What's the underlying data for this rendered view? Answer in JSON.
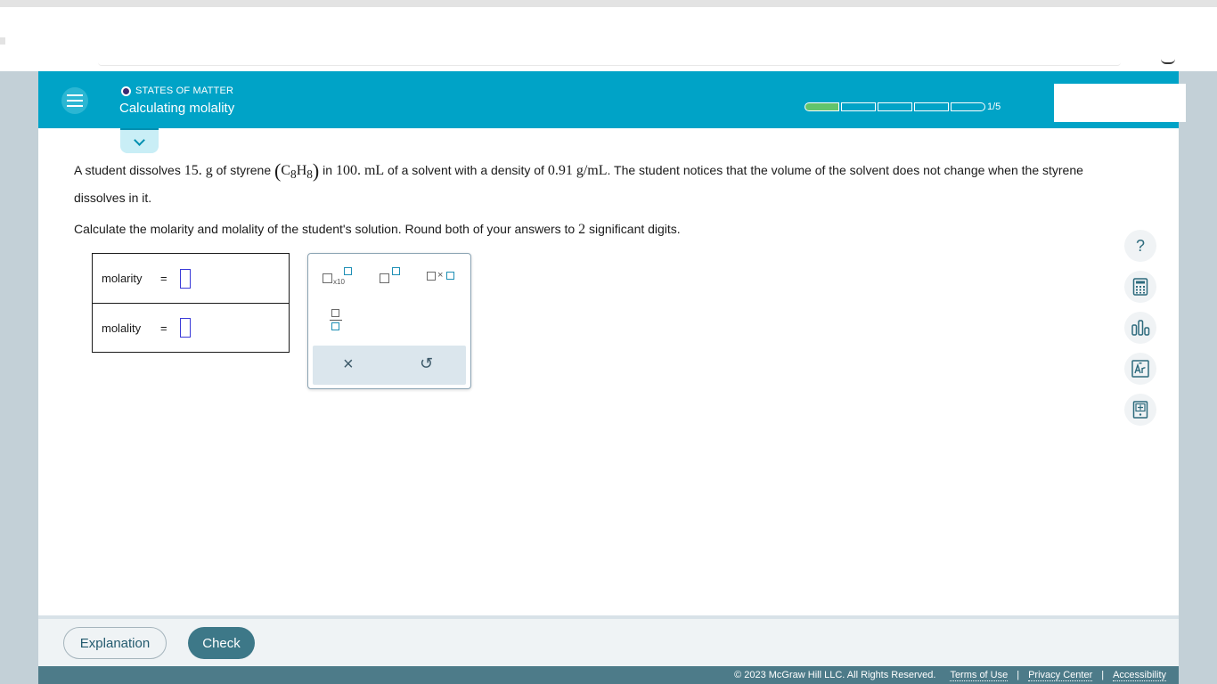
{
  "header": {
    "topic_label": "STATES OF MATTER",
    "title": "Calculating molality",
    "progress_label": "1/5",
    "progress_total": 5,
    "progress_done": 1,
    "accent_color": "#00a3c7",
    "progress_color": "#62c46b"
  },
  "problem": {
    "p1_a": "A student dissolves ",
    "p1_mass": "15. g",
    "p1_b": " of styrene ",
    "p1_formula_c": "C",
    "p1_formula_c_sub": "8",
    "p1_formula_h": "H",
    "p1_formula_h_sub": "8",
    "p1_c": " in ",
    "p1_volume": "100. mL",
    "p1_d": " of a solvent with a density of ",
    "p1_density": "0.91  g/mL",
    "p1_e": ". The student notices that the volume of the solvent does not change when the styrene dissolves in it.",
    "p2_a": "Calculate the molarity and molality of the student's solution. Round both of your answers to ",
    "p2_digits": "2",
    "p2_b": " significant digits."
  },
  "answers": {
    "molarity_label": "molarity",
    "molality_label": "molality",
    "equals": "="
  },
  "palette": {
    "x10_label": "x10",
    "times_symbol": "×",
    "clear_symbol": "×",
    "undo_symbol": "↺"
  },
  "tools": {
    "help_symbol": "?"
  },
  "footer": {
    "explanation_label": "Explanation",
    "check_label": "Check",
    "copyright": "© 2023 McGraw Hill LLC. All Rights Reserved.",
    "terms": "Terms of Use",
    "privacy": "Privacy Center",
    "accessibility": "Accessibility",
    "separator": "|"
  }
}
